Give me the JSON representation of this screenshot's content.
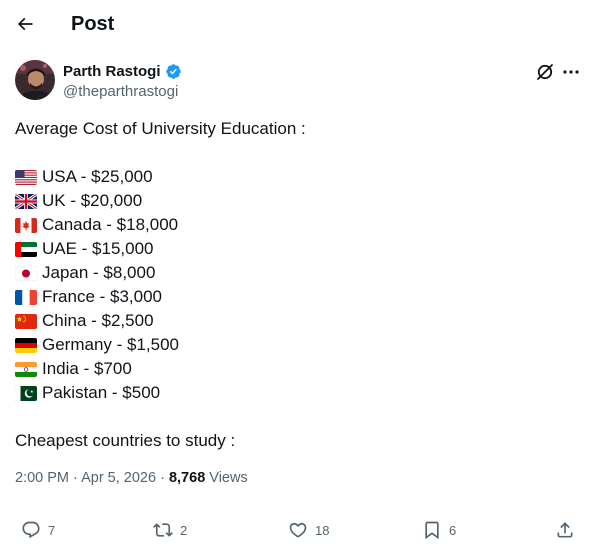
{
  "header": {
    "title": "Post",
    "back_icon": "arrow-left-icon"
  },
  "author": {
    "name": "Parth Rastogi",
    "handle": "@theparthrastogi",
    "verified": true,
    "verified_color": "#1d9bf0"
  },
  "post": {
    "intro": "Average Cost of University Education :",
    "items": [
      {
        "flag": "flag-usa-icon",
        "text": "USA - $25,000"
      },
      {
        "flag": "flag-uk-icon",
        "text": "UK - $20,000"
      },
      {
        "flag": "flag-canada-icon",
        "text": "Canada - $18,000"
      },
      {
        "flag": "flag-uae-icon",
        "text": "UAE - $15,000"
      },
      {
        "flag": "flag-japan-icon",
        "text": "Japan - $8,000"
      },
      {
        "flag": "flag-france-icon",
        "text": "France - $3,000"
      },
      {
        "flag": "flag-china-icon",
        "text": "China - $2,500"
      },
      {
        "flag": "flag-germany-icon",
        "text": "Germany - $1,500"
      },
      {
        "flag": "flag-india-icon",
        "text": "India - $700"
      },
      {
        "flag": "flag-pakistan-icon",
        "text": "Pakistan - $500"
      }
    ],
    "outro": "Cheapest countries to study :"
  },
  "meta": {
    "time": "2:00 PM",
    "date": "Apr 5, 2026",
    "views_count": "8,768",
    "views_label": "Views"
  },
  "actions": {
    "replies": "7",
    "reposts": "2",
    "likes": "18",
    "bookmarks": "6"
  },
  "colors": {
    "text": "#0f1419",
    "muted": "#536471",
    "accent": "#1d9bf0"
  }
}
